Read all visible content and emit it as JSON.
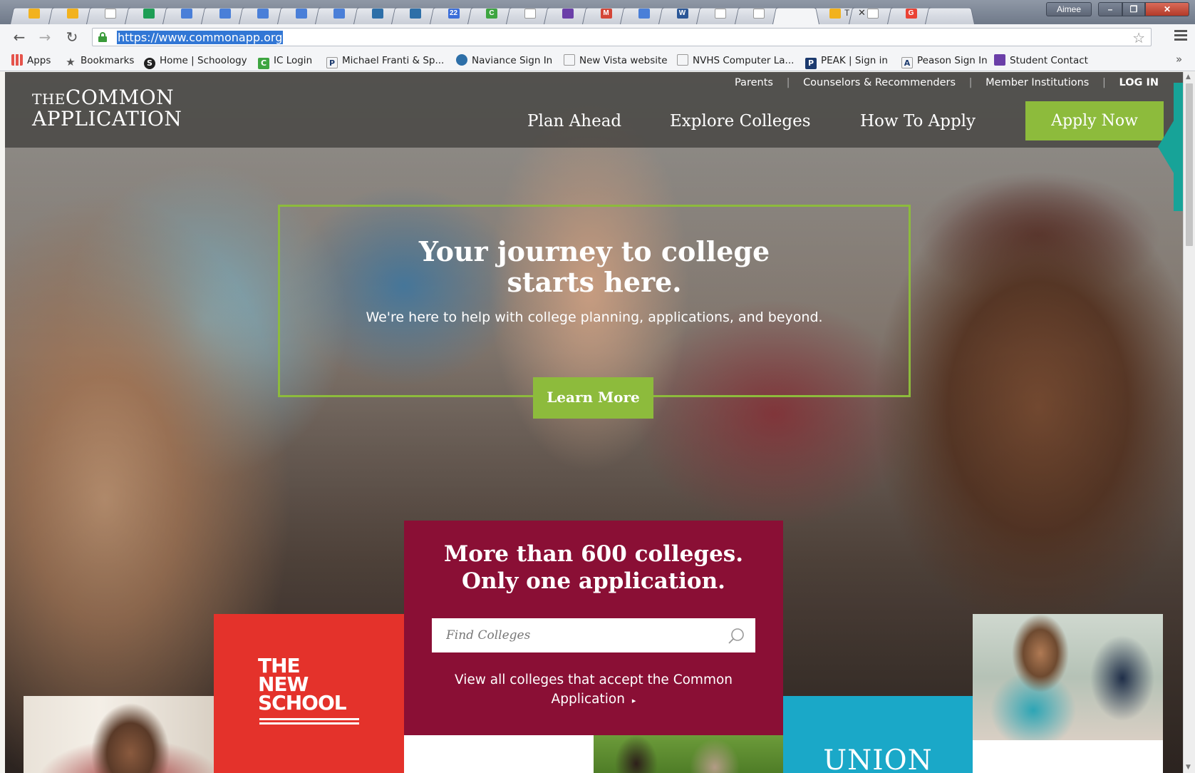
{
  "browser": {
    "tabs": [
      {
        "icon": "slides-icon",
        "color": "#f2b21e"
      },
      {
        "icon": "slides-icon",
        "color": "#f2b21e"
      },
      {
        "icon": "blank-page-icon",
        "color": "#ffffff"
      },
      {
        "icon": "sheets-icon",
        "color": "#1e9e55"
      },
      {
        "icon": "docs-icon",
        "color": "#4a7fd8"
      },
      {
        "icon": "docs-icon",
        "color": "#4a7fd8"
      },
      {
        "icon": "docs-icon",
        "color": "#4a7fd8"
      },
      {
        "icon": "docs-icon",
        "color": "#4a7fd8"
      },
      {
        "icon": "docs-icon",
        "color": "#4a7fd8"
      },
      {
        "icon": "globe-icon",
        "color": "#2d6fa8"
      },
      {
        "icon": "globe-icon",
        "color": "#2d6fa8"
      },
      {
        "icon": "calendar-icon",
        "color": "#3b6ed9",
        "text": "22"
      },
      {
        "icon": "ic-icon",
        "color": "#3ea541",
        "text": "C"
      },
      {
        "icon": "blank-page-icon",
        "color": "#ffffff"
      },
      {
        "icon": "forms-icon",
        "color": "#6b3fa8"
      },
      {
        "icon": "gmail-icon",
        "color": "#d44638",
        "text": "M"
      },
      {
        "icon": "docs-icon",
        "color": "#4a7fd8"
      },
      {
        "icon": "word-icon",
        "color": "#2b5797",
        "text": "W"
      },
      {
        "icon": "blank-page-icon",
        "color": "#ffffff"
      },
      {
        "icon": "blank-page-icon",
        "color": "#ffffff"
      },
      {
        "icon": "active-tab",
        "color": "#ffffff"
      },
      {
        "icon": "drive-icon",
        "color": "#f2b21e"
      },
      {
        "icon": "blank-page-icon",
        "color": "#ffffff"
      },
      {
        "icon": "google-icon",
        "color": "#ea4335",
        "text": "G"
      },
      {
        "icon": "new-tab",
        "color": "#ffffff"
      }
    ],
    "active_tab_label": "T",
    "profile_name": "Aimee",
    "url": "https://www.commonapp.org",
    "bookmarks": [
      {
        "label": "Apps",
        "icon": "apps-grid-icon",
        "color": "#e5534b"
      },
      {
        "label": "Bookmarks",
        "icon": "star-icon",
        "color": "#555555"
      },
      {
        "label": "Home | Schoology",
        "icon": "schoology-icon",
        "color": "#222222",
        "glyph": "S"
      },
      {
        "label": "IC Login",
        "icon": "ic-icon",
        "color": "#3ea541",
        "glyph": "C"
      },
      {
        "label": "Michael Franti & Sp...",
        "icon": "pandora-icon",
        "color": "#ffffff",
        "glyph": "P"
      },
      {
        "label": "Naviance Sign In",
        "icon": "globe-icon",
        "color": "#2d6fa8"
      },
      {
        "label": "New Vista website",
        "icon": "blank-page-icon",
        "color": "#ffffff"
      },
      {
        "label": "NVHS Computer La...",
        "icon": "blank-page-icon",
        "color": "#ffffff"
      },
      {
        "label": "PEAK | Sign in",
        "icon": "peak-icon",
        "color": "#1c3a6e",
        "glyph": "P"
      },
      {
        "label": "Peason Sign In",
        "icon": "pearson-icon",
        "color": "#ffffff",
        "glyph": "A"
      },
      {
        "label": "Student Contact",
        "icon": "forms-icon",
        "color": "#6b3fa8"
      }
    ],
    "bookmarks_more": "»"
  },
  "site": {
    "logo_line1_prefix": "THE",
    "logo_line1": "COMMON",
    "logo_line2": "APPLICATION",
    "util_nav": [
      "Parents",
      "Counselors & Recommenders",
      "Member Institutions"
    ],
    "util_sep": "|",
    "login": "LOG IN",
    "main_nav": [
      "Plan Ahead",
      "Explore Colleges",
      "How To Apply"
    ],
    "apply_now": "Apply Now",
    "accent_green": "#8dbb3c",
    "maroon": "#8a0f35"
  },
  "hero": {
    "title_line1": "Your journey to college",
    "title_line2": "starts here.",
    "subtitle": "We're here to help with college planning, applications, and beyond.",
    "cta": "Learn More"
  },
  "colleges": {
    "heading_line1": "More than 600 colleges.",
    "heading_line2": "Only one application.",
    "search_placeholder": "Find Colleges",
    "view_all_line1": "View all colleges that accept the Common",
    "view_all_line2": "Application",
    "view_all_caret": "▸"
  },
  "tiles": {
    "new_school_line1": "THE",
    "new_school_line2": "NEW",
    "new_school_line3": "SCHOOL",
    "union": "UNION"
  }
}
